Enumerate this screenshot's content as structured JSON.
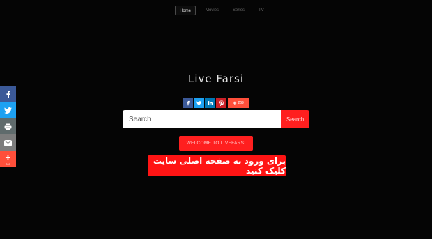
{
  "nav": {
    "items": [
      {
        "label": "Home",
        "active": true
      },
      {
        "label": "Movies",
        "active": false
      },
      {
        "label": "Series",
        "active": false
      },
      {
        "label": "TV",
        "active": false
      }
    ]
  },
  "site_title": "Live Farsi",
  "share_side": {
    "buttons": [
      "facebook-icon",
      "twitter-icon",
      "print-icon",
      "email-icon",
      "plus-icon"
    ],
    "count": "269"
  },
  "share_row": {
    "buttons": [
      "facebook-icon",
      "twitter-icon",
      "linkedin-icon",
      "pinterest-icon",
      "plus-icon"
    ],
    "count": "269"
  },
  "search": {
    "placeholder": "Search",
    "button_label": "Search"
  },
  "welcome_label": "WELCOME TO LIVEFARSI",
  "enter_label": "برای ورود به صفحه اصلی سایت کلیک کنید",
  "colors": {
    "background": "#050505",
    "accent": "#ff1f1f",
    "facebook": "#3b5998",
    "twitter": "#1da1f2",
    "linkedin": "#0077b5",
    "pinterest": "#cb2027",
    "share_more": "#ff4f3a"
  }
}
